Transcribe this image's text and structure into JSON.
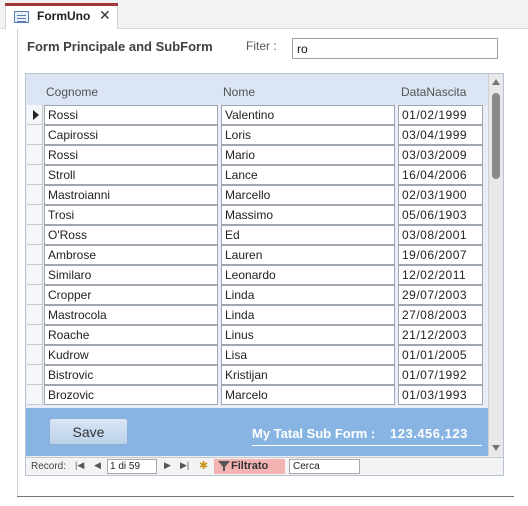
{
  "tab": {
    "title": "FormUno",
    "icon": "form-icon",
    "close_icon": "close-icon"
  },
  "header": {
    "title": "Form Principale and SubForm",
    "filter_label": "Fiter :",
    "filter_value": "ro"
  },
  "grid": {
    "columns": [
      "Cognome",
      "Nome",
      "DataNascita"
    ],
    "current_row": 0,
    "rows": [
      [
        "Rossi",
        "Valentino",
        "01/02/1999"
      ],
      [
        "Capirossi",
        "Loris",
        "03/04/1999"
      ],
      [
        "Rossi",
        "Mario",
        "03/03/2009"
      ],
      [
        "Stroll",
        "Lance",
        "16/04/2006"
      ],
      [
        "Mastroianni",
        "Marcello",
        "02/03/1900"
      ],
      [
        "Trosi",
        "Massimo",
        "05/06/1903"
      ],
      [
        "O'Ross",
        "Ed",
        "03/08/2001"
      ],
      [
        "Ambrose",
        "Lauren",
        "19/06/2007"
      ],
      [
        "Similaro",
        "Leonardo",
        "12/02/2011"
      ],
      [
        "Cropper",
        "Linda",
        "29/07/2003"
      ],
      [
        "Mastrocola",
        "Linda",
        "27/08/2003"
      ],
      [
        "Roache",
        "Linus",
        "21/12/2003"
      ],
      [
        "Kudrow",
        "Lisa",
        "01/01/2005"
      ],
      [
        "Bistrovic",
        "Kristijan",
        "01/07/1992"
      ],
      [
        "Brozovic",
        "Marcelo",
        "01/03/1993"
      ]
    ]
  },
  "footer": {
    "save_label": "Save",
    "total_label": "My Tatal Sub Form  :",
    "total_value": "123.456,123"
  },
  "navigation": {
    "record_label": "Record:",
    "position": "1 di 59",
    "filter_label": "Filtrato",
    "search_placeholder": "Cerca"
  },
  "colors": {
    "accent_tab": "#a4373a",
    "footer_bg": "#87b4e2",
    "header_bg": "#dbe5f3",
    "filter_chip": "#f3b3b3"
  }
}
